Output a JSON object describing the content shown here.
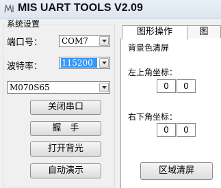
{
  "window": {
    "title": "MIS UART TOOLS V2.09",
    "icon": "mis-logo-icon"
  },
  "system_settings": {
    "group_title": "系统设置",
    "port_label": "端口号：",
    "port_value": "COM7",
    "baud_label": "波特率：",
    "baud_value": "115200",
    "model_value": "M070S65",
    "close_port_button": "关闭串口",
    "handshake_button": "握　手",
    "backlight_button": "打开背光",
    "auto_demo_button": "自动演示"
  },
  "tabs": [
    {
      "label": "图形操作",
      "active": true
    },
    {
      "label": "图",
      "active": false
    }
  ],
  "graphics_panel": {
    "bg_clear_label": "背景色清屏",
    "top_left_label": "左上角坐标：",
    "top_left_x": "0",
    "top_left_y": "0",
    "bottom_right_label": "右下角坐标：",
    "bottom_right_x": "0",
    "bottom_right_y": "0",
    "region_clear_button": "区域清屏"
  },
  "colors": {
    "selection": "#3399ff",
    "window_bg": "#f0f0f0"
  }
}
